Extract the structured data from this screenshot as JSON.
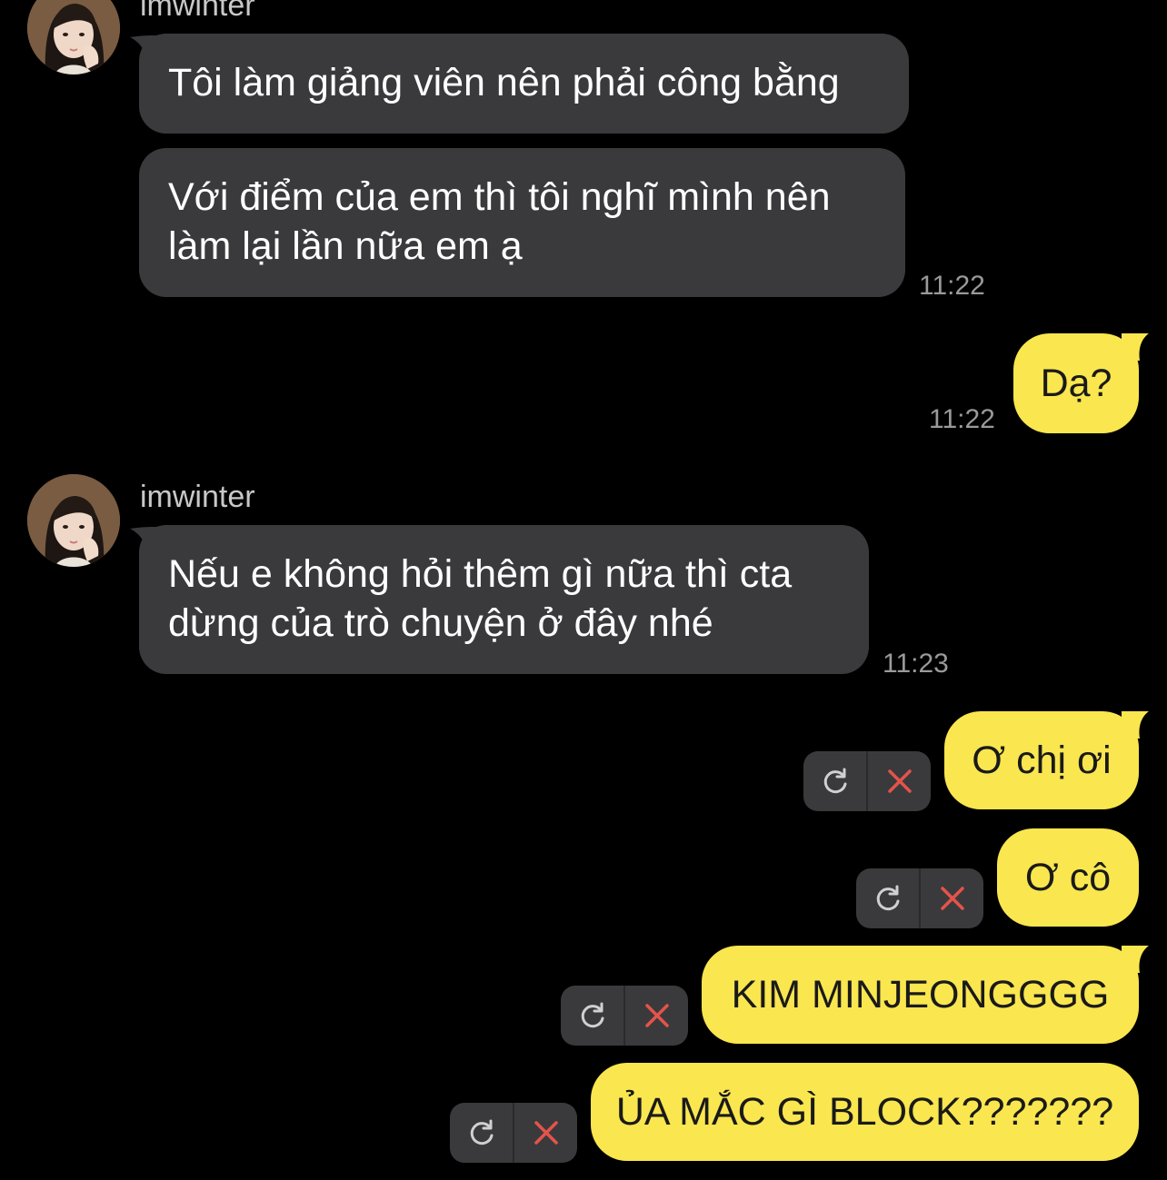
{
  "sender": {
    "name": "imwinter"
  },
  "messages": {
    "m1": "Tôi làm giảng viên nên phải công bằng",
    "m2": "Với điểm của em thì tôi nghĩ mình nên làm lại lần nữa em ạ",
    "m2_time": "11:22",
    "m3": "Dạ?",
    "m3_time": "11:22",
    "m4": "Nếu e không hỏi thêm gì nữa thì cta dừng của trò chuyện ở đây nhé",
    "m4_time": "11:23",
    "m5": "Ơ chị ơi",
    "m6": "Ơ cô",
    "m7": "KIM MINJEONGGGG",
    "m8": "ỦA MẮC GÌ BLOCK???????"
  },
  "colors": {
    "background": "#000000",
    "incoming_bubble": "#3a3a3c",
    "outgoing_bubble": "#fae64f",
    "failed_cancel": "#e5534b",
    "retry_icon": "#d0d0d0"
  },
  "icons": {
    "retry": "retry-icon",
    "cancel": "close-icon",
    "avatar": "avatar-photo"
  }
}
